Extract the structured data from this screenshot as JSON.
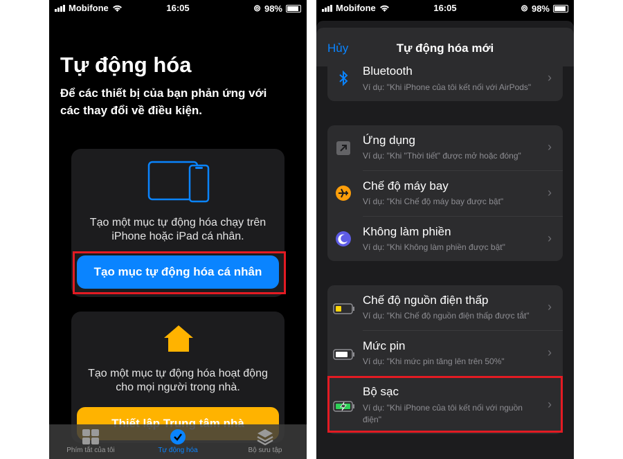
{
  "status": {
    "carrier": "Mobifone",
    "time": "16:05",
    "battery": "98%"
  },
  "left": {
    "title": "Tự động hóa",
    "subtitle": "Để các thiết bị của bạn phản ứng với các thay đổi về điều kiện.",
    "personal_card": {
      "text": "Tạo một mục tự động hóa chạy trên iPhone hoặc iPad cá nhân.",
      "button": "Tạo mục tự động hóa cá nhân"
    },
    "home_card": {
      "text": "Tạo một mục tự động hóa hoạt động cho mọi người trong nhà.",
      "button": "Thiết lập Trung tâm nhà"
    },
    "tabs": [
      {
        "label": "Phím tắt của tôi"
      },
      {
        "label": "Tự động hóa"
      },
      {
        "label": "Bộ sưu tập"
      }
    ],
    "active_tab": 1
  },
  "right": {
    "nav": {
      "cancel": "Hủy",
      "title": "Tự động hóa mới"
    },
    "rows": [
      {
        "title": "Bluetooth",
        "subtitle": "Ví dụ: \"Khi iPhone của tôi kết nối với AirPods\"",
        "icon": "bluetooth-icon"
      },
      {
        "title": "Ứng dụng",
        "subtitle": "Ví dụ: \"Khi \"Thời tiết\" được mở hoặc đóng\"",
        "icon": "app-arrow-icon"
      },
      {
        "title": "Chế độ máy bay",
        "subtitle": "Ví dụ: \"Khi Chế độ máy bay được bật\"",
        "icon": "airplane-icon"
      },
      {
        "title": "Không làm phiền",
        "subtitle": "Ví dụ: \"Khi Không làm phiền được bật\"",
        "icon": "moon-icon"
      },
      {
        "title": "Chế độ nguồn điện thấp",
        "subtitle": "Ví dụ: \"Khi Chế độ nguồn điện thấp được tắt\"",
        "icon": "low-power-battery-icon"
      },
      {
        "title": "Mức pin",
        "subtitle": "Ví dụ: \"Khi mức pin tăng lên trên 50%\"",
        "icon": "battery-level-icon"
      },
      {
        "title": "Bộ sạc",
        "subtitle": "Ví dụ: \"Khi iPhone của tôi kết nối với nguồn điện\"",
        "icon": "charger-icon"
      }
    ]
  },
  "colors": {
    "accent": "#0a84ff",
    "highlight": "#e31b23",
    "home": "#ffb300"
  }
}
